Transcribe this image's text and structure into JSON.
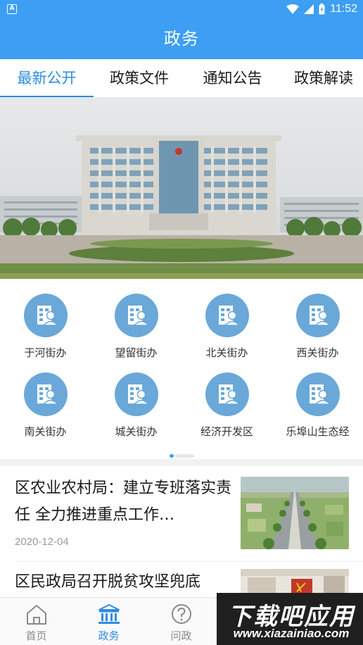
{
  "status_bar": {
    "time": "11:52",
    "badge": "A"
  },
  "header": {
    "title": "政务"
  },
  "tabs": [
    {
      "label": "最新公开",
      "active": true
    },
    {
      "label": "政策文件",
      "active": false
    },
    {
      "label": "通知公告",
      "active": false
    },
    {
      "label": "政策解读",
      "active": false
    }
  ],
  "banner": {
    "image": "government-building-photo"
  },
  "grid": {
    "icon": "office-person-icon",
    "items": [
      {
        "label": "于河街办"
      },
      {
        "label": "望留街办"
      },
      {
        "label": "北关街办"
      },
      {
        "label": "西关街办"
      },
      {
        "label": "南关街办"
      },
      {
        "label": "城关街办"
      },
      {
        "label": "经济开发区"
      },
      {
        "label": "乐埠山生态经"
      }
    ],
    "page_indicator": {
      "current": 1,
      "total": 2
    }
  },
  "news": [
    {
      "title": "区农业农村局：建立专班落实责任 全力推进重点工作…",
      "date": "2020-12-04",
      "thumbnail": "aerial-road-farmland-photo"
    },
    {
      "title": "区民政局召开脱贫攻坚兜底",
      "date": "",
      "thumbnail": "meeting-room-photo"
    }
  ],
  "bottom_nav": [
    {
      "label": "首页",
      "icon": "home-icon",
      "active": false
    },
    {
      "label": "政务",
      "icon": "government-building-icon",
      "active": true
    },
    {
      "label": "问政",
      "icon": "question-circle-icon",
      "active": false
    }
  ],
  "watermark": {
    "title": "下载吧应用",
    "url": "www.xiazainiao.com"
  },
  "colors": {
    "primary": "#3d9ef4",
    "tab_active": "#2d8ce3",
    "icon_circle": "#6aa8d9"
  }
}
